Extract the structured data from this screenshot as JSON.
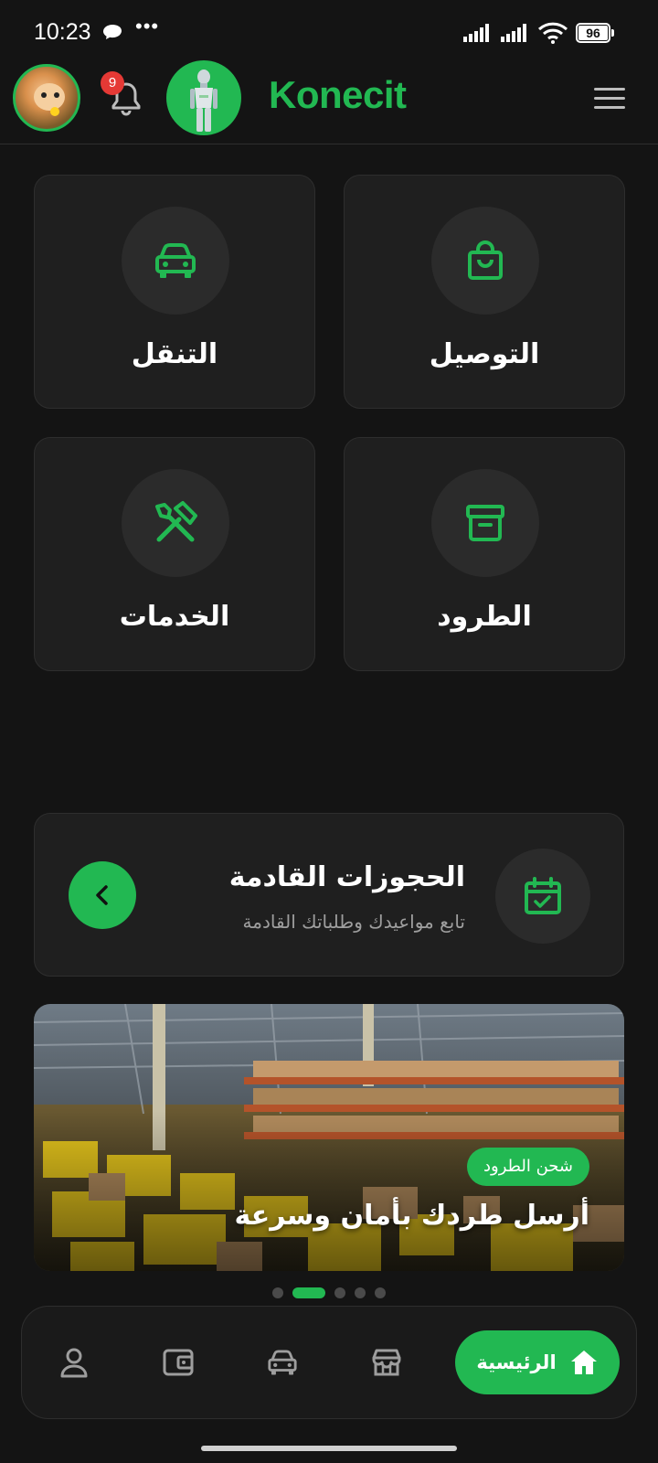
{
  "status_bar": {
    "time": "10:23",
    "dots": "•••",
    "battery": "96"
  },
  "header": {
    "notification_count": "9",
    "brand": "Konecit"
  },
  "categories": [
    {
      "label": "التوصيل",
      "icon": "shopping-bag-icon"
    },
    {
      "label": "التنقل",
      "icon": "car-icon"
    },
    {
      "label": "الطرود",
      "icon": "archive-box-icon"
    },
    {
      "label": "الخدمات",
      "icon": "tools-icon"
    }
  ],
  "upcoming": {
    "title": "الحجوزات القادمة",
    "subtitle": "تابع مواعيدك وطلباتك القادمة"
  },
  "banner": {
    "tag": "شحن الطرود",
    "headline": "أرسل طردك بأمان وسرعة"
  },
  "carousel": {
    "total": 5,
    "active": 2
  },
  "bottom_nav": {
    "home_label": "الرئيسية"
  },
  "colors": {
    "accent": "#22b852",
    "background": "#141414",
    "card": "#1f1f1f"
  }
}
